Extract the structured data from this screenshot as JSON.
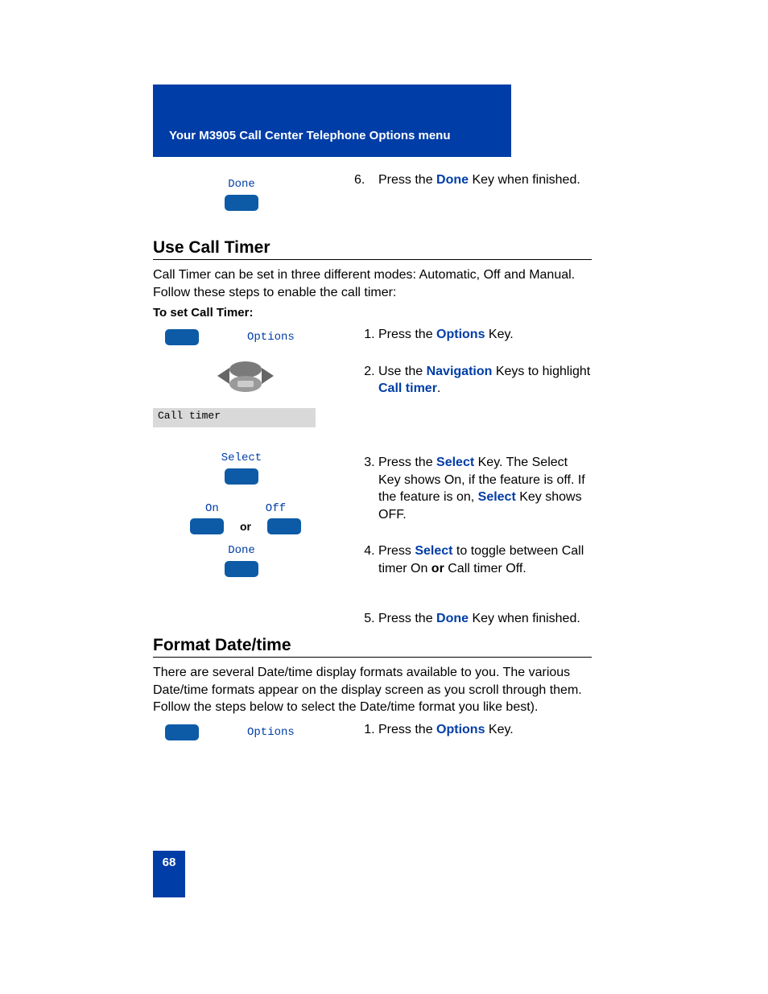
{
  "banner": {
    "title": "Your M3905 Call Center Telephone Options menu"
  },
  "intro_key": {
    "label": "Done"
  },
  "intro_step": {
    "num": "6.",
    "pre": "Press the ",
    "kw": "Done",
    "post": " Key when finished."
  },
  "section_timer": {
    "heading": "Use Call Timer",
    "intro": "Call Timer can be set in three different modes: Automatic, Off and Manual. Follow these steps to enable the call timer:",
    "subhead": "To set Call Timer:",
    "options_label": "Options",
    "lcd_text": "Call timer",
    "select_label": "Select",
    "on_label": "On",
    "off_label": "Off",
    "or_label": "or",
    "done_label": "Done",
    "steps": {
      "s1": {
        "pre": "Press the ",
        "kw": "Options",
        "post": " Key."
      },
      "s2": {
        "pre": "Use the ",
        "kw1": "Navigation",
        "mid": " Keys to highlight ",
        "kw2": "Call timer",
        "post": "."
      },
      "s3": {
        "pre": "Press the ",
        "kw1": "Select",
        "mid1": " Key. The Select Key shows On, if the feature is off. If the feature is on, ",
        "kw2": "Select",
        "post": " Key shows OFF."
      },
      "s4": {
        "pre": "Press ",
        "kw": "Select",
        "mid1": " to toggle between Call timer On ",
        "bold": "or",
        "post": " Call timer Off."
      },
      "s5": {
        "pre": "Press the ",
        "kw": "Done",
        "post": " Key when finished."
      }
    }
  },
  "section_date": {
    "heading": "Format Date/time",
    "intro": "There are several Date/time display formats available to you. The various Date/time formats appear on the display screen as you scroll through them. Follow the steps below to select the Date/time format you like best).",
    "options_label": "Options",
    "steps": {
      "s1": {
        "pre": "Press the ",
        "kw": "Options",
        "post": " Key."
      }
    }
  },
  "page_number": "68"
}
